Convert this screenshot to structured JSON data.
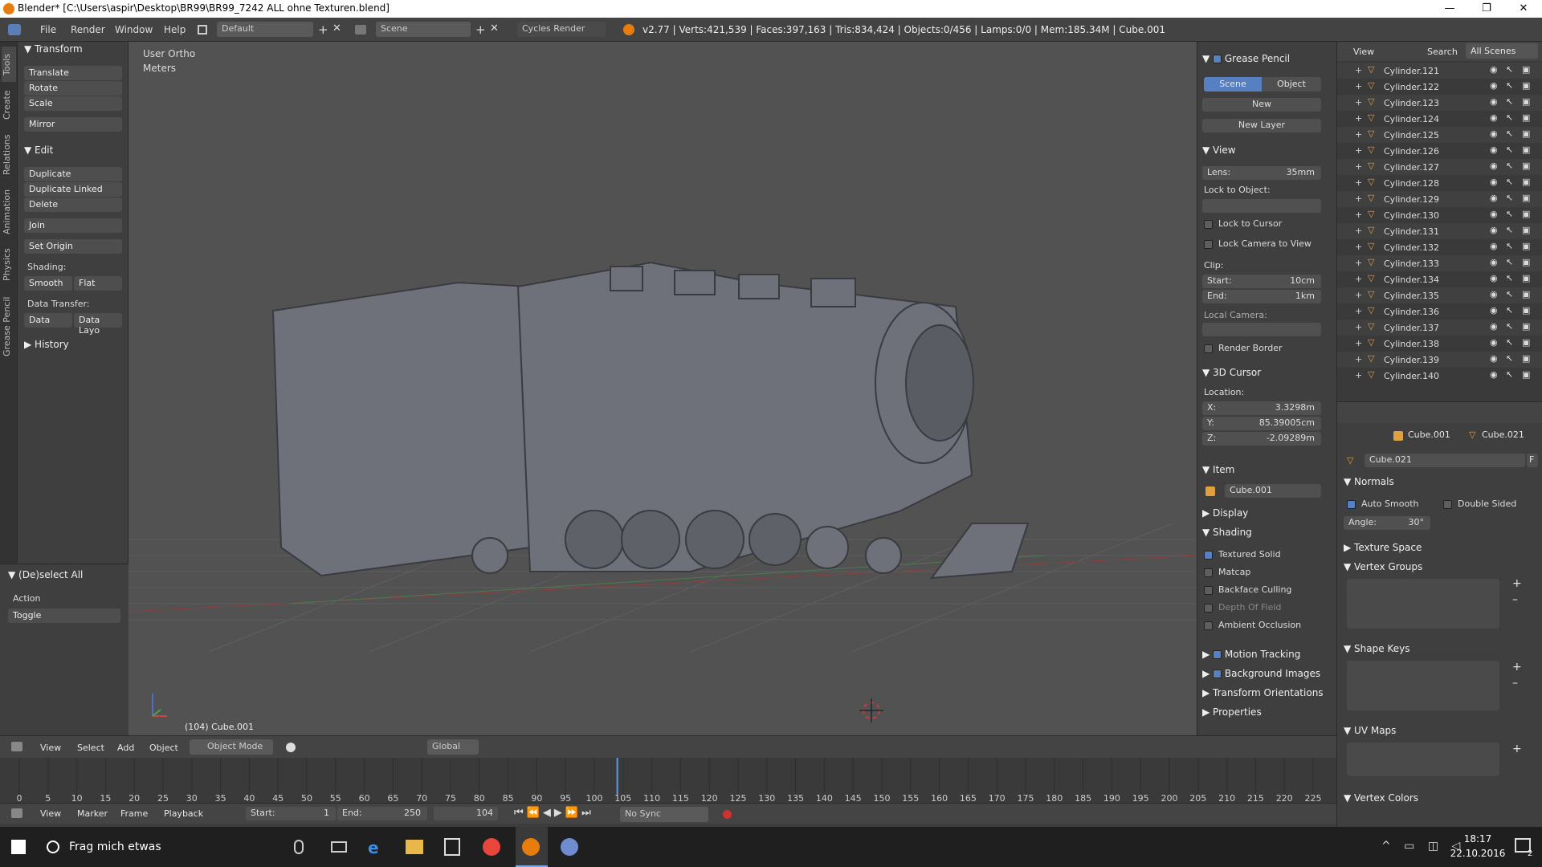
{
  "window": {
    "title": "Blender* [C:\\Users\\aspir\\Desktop\\BR99\\BR99_7242 ALL ohne Texturen.blend]"
  },
  "menubar": {
    "items": [
      "File",
      "Render",
      "Window",
      "Help"
    ],
    "layout": "Default",
    "scene": "Scene",
    "engine": "Cycles Render",
    "stats": "v2.77 | Verts:421,539 | Faces:397,163 | Tris:834,424 | Objects:0/456 | Lamps:0/0 | Mem:185.34M | Cube.001"
  },
  "tool_tabs": [
    "Tools",
    "Create",
    "Relations",
    "Animation",
    "Physics",
    "Grease Pencil"
  ],
  "toolshelf": {
    "transform": {
      "title": "Transform",
      "translate": "Translate",
      "rotate": "Rotate",
      "scale": "Scale",
      "mirror": "Mirror"
    },
    "edit": {
      "title": "Edit",
      "duplicate": "Duplicate",
      "duplicate_linked": "Duplicate Linked",
      "delete": "Delete",
      "join": "Join",
      "set_origin": "Set Origin",
      "shading": "Shading:",
      "smooth": "Smooth",
      "flat": "Flat",
      "data_transfer": "Data Transfer:",
      "data": "Data",
      "data_layo": "Data Layo"
    },
    "history": "History",
    "operator": {
      "title": "(De)select All",
      "action": "Action",
      "toggle": "Toggle"
    }
  },
  "viewport": {
    "view_name": "User Ortho",
    "units": "Meters",
    "object_label": "(104) Cube.001"
  },
  "npanel": {
    "grease": {
      "title": "Grease Pencil",
      "scene": "Scene",
      "object": "Object",
      "new": "New",
      "new_layer": "New Layer"
    },
    "view": {
      "title": "View",
      "lens_label": "Lens:",
      "lens": "35mm",
      "lock_to_object": "Lock to Object:",
      "lock_cursor": "Lock to Cursor",
      "lock_camera": "Lock Camera to View",
      "clip": "Clip:",
      "start_label": "Start:",
      "start": "10cm",
      "end_label": "End:",
      "end": "1km",
      "local_camera": "Local Camera:",
      "render_border": "Render Border"
    },
    "cursor": {
      "title": "3D Cursor",
      "location": "Location:",
      "x_label": "X:",
      "x": "3.3298m",
      "y_label": "Y:",
      "y": "85.39005cm",
      "z_label": "Z:",
      "z": "-2.09289m"
    },
    "item": {
      "title": "Item",
      "name": "Cube.001"
    },
    "display": "Display",
    "shading": {
      "title": "Shading",
      "textured_solid": "Textured Solid",
      "matcap": "Matcap",
      "backface": "Backface Culling",
      "dof": "Depth Of Field",
      "ao": "Ambient Occlusion"
    },
    "motion_tracking": "Motion Tracking",
    "bg_images": "Background Images",
    "transform_orient": "Transform Orientations",
    "properties": "Properties"
  },
  "outliner": {
    "view": "View",
    "search": "Search",
    "all_scenes": "All Scenes",
    "rows": [
      "Cylinder.121",
      "Cylinder.122",
      "Cylinder.123",
      "Cylinder.124",
      "Cylinder.125",
      "Cylinder.126",
      "Cylinder.127",
      "Cylinder.128",
      "Cylinder.129",
      "Cylinder.130",
      "Cylinder.131",
      "Cylinder.132",
      "Cylinder.133",
      "Cylinder.134",
      "Cylinder.135",
      "Cylinder.136",
      "Cylinder.137",
      "Cylinder.138",
      "Cylinder.139",
      "Cylinder.140"
    ]
  },
  "properties": {
    "obj": "Cube.001",
    "mesh": "Cube.021",
    "mesh_field": "Cube.021",
    "f": "F",
    "normals": "Normals",
    "auto_smooth": "Auto Smooth",
    "double_sided": "Double Sided",
    "angle_label": "Angle:",
    "angle": "30°",
    "texture_space": "Texture Space",
    "vertex_groups": "Vertex Groups",
    "shape_keys": "Shape Keys",
    "uv_maps": "UV Maps",
    "vertex_colors": "Vertex Colors"
  },
  "view_header": {
    "view": "View",
    "select": "Select",
    "add": "Add",
    "object": "Object",
    "mode": "Object Mode",
    "orientation": "Global"
  },
  "timeline": {
    "ticks": [
      "0",
      "5",
      "10",
      "15",
      "20",
      "25",
      "30",
      "35",
      "40",
      "45",
      "50",
      "55",
      "60",
      "65",
      "70",
      "75",
      "80",
      "85",
      "90",
      "95",
      "100",
      "105",
      "110",
      "115",
      "120",
      "125",
      "130",
      "135",
      "140",
      "145",
      "150",
      "155",
      "160",
      "165",
      "170",
      "175",
      "180",
      "185",
      "190",
      "195",
      "200",
      "205",
      "210",
      "215",
      "220",
      "225"
    ],
    "current_frame": 104,
    "view": "View",
    "marker": "Marker",
    "frame": "Frame",
    "playback": "Playback",
    "start_label": "Start:",
    "start": "1",
    "end_label": "End:",
    "end": "250",
    "frame_value": "104",
    "sync": "No Sync"
  },
  "taskbar": {
    "search": "Frag mich etwas",
    "time": "18:17",
    "date": "22.10.2016",
    "notif": "2"
  }
}
